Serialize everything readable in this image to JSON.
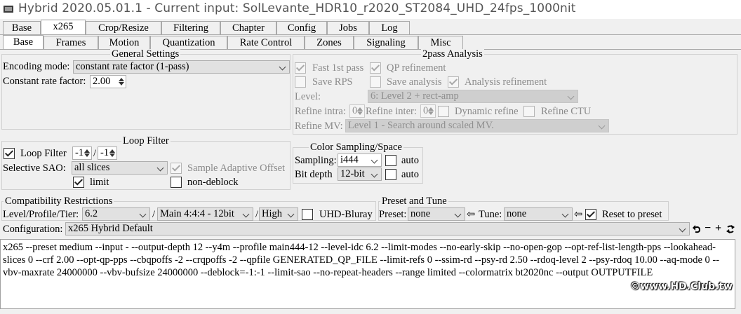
{
  "window": {
    "title": "Hybrid 2020.05.01.1 - Current input: SolLevante_HDR10_r2020_ST2084_UHD_24fps_1000nit"
  },
  "main_tabs": [
    "Base",
    "x265",
    "Crop/Resize",
    "Filtering",
    "Chapter",
    "Config",
    "Jobs",
    "Log"
  ],
  "sub_tabs": [
    "Base",
    "Frames",
    "Motion",
    "Quantization",
    "Rate Control",
    "Zones",
    "Signaling",
    "Misc"
  ],
  "general": {
    "title": "General Settings",
    "encoding_mode_label": "Encoding mode:",
    "encoding_mode_value": "constant rate factor (1-pass)",
    "crf_label": "Constant rate factor:",
    "crf_value": "2.00"
  },
  "twopass": {
    "title": "2pass Analysis",
    "fast_1st_pass": "Fast 1st pass",
    "qp_refinement": "QP refinement",
    "save_rps": "Save RPS",
    "save_analysis": "Save analysis",
    "analysis_refinement": "Analysis refinement",
    "level_label": "Level:",
    "level_value": "6: Level 2 + rect-amp",
    "refine_intra_label": "Refine intra:",
    "refine_intra_value": "0",
    "refine_inter_label": "Refine inter:",
    "refine_inter_value": "0",
    "dynamic_refine": "Dynamic refine",
    "refine_ctu": "Refine CTU",
    "refine_mv_label": "Refine MV:",
    "refine_mv_value": "Level 1 - Search around scaled MV."
  },
  "loop_filter": {
    "title": "Loop Filter",
    "loop_filter_label": "Loop Filter",
    "value_a": "-1",
    "separator": "/",
    "value_b": "-1",
    "selective_sao_label": "Selective SAO:",
    "selective_sao_value": "all slices",
    "sao_label": "Sample Adaptive Offset",
    "limit_label": "limit",
    "non_deblock_label": "non-deblock"
  },
  "color": {
    "title": "Color Sampling/Space",
    "sampling_label": "Sampling:",
    "sampling_value": "i444",
    "bitdepth_label": "Bit depth",
    "bitdepth_value": "12-bit",
    "auto_label": "auto"
  },
  "compat": {
    "title": "Compatibility Restrictions",
    "lpt_label": "Level/Profile/Tier:",
    "level_value": "6.2",
    "sep": "/",
    "profile_value": "Main 4:4:4 - 12bit",
    "tier_value": "High",
    "uhd_bluray_label": "UHD-Bluray"
  },
  "preset": {
    "title": "Preset and Tune",
    "preset_label": "Preset:",
    "preset_value": "none",
    "arrow": "⇦",
    "tune_label": "Tune:",
    "tune_value": "none",
    "reset_label": "Reset to preset"
  },
  "configuration": {
    "label": "Configuration:",
    "value": "x265 Hybrid Default",
    "minus": "−",
    "plus": "+"
  },
  "command_line": "x265 --preset medium --input - --output-depth 12 --y4m --profile main444-12 --level-idc 6.2 --limit-modes --no-early-skip --no-open-gop --opt-ref-list-length-pps --lookahead-slices 0 --crf 2.00 --opt-qp-pps --cbqpoffs -2 --crqpoffs -2  --qpfile GENERATED_QP_FILE --limit-refs 0 --ssim-rd --psy-rd 2.50 --rdoq-level 2 --psy-rdoq 10.00 --aq-mode 0 --vbv-maxrate 24000000 --vbv-bufsize 24000000 --deblock=-1:-1 --limit-sao --no-repeat-headers --range limited --colormatrix bt2020nc --output OUTPUTFILE",
  "watermark": "©www.HD.Club.tw",
  "checkbox_states": {
    "loop_filter": true,
    "sao": true,
    "limit": true,
    "non_deblock": false,
    "fast_1st_pass": true,
    "qp_refinement": true,
    "save_rps": false,
    "save_analysis": false,
    "analysis_refinement": true,
    "dynamic_refine": false,
    "refine_ctu": false,
    "sampling_auto": false,
    "bitdepth_auto": false,
    "uhd_bluray": false,
    "reset_to_preset": true
  },
  "colors": {
    "window_bg": "#f0f0f0",
    "border": "#a9a9a9",
    "disabled_text": "#8a8a8a"
  }
}
